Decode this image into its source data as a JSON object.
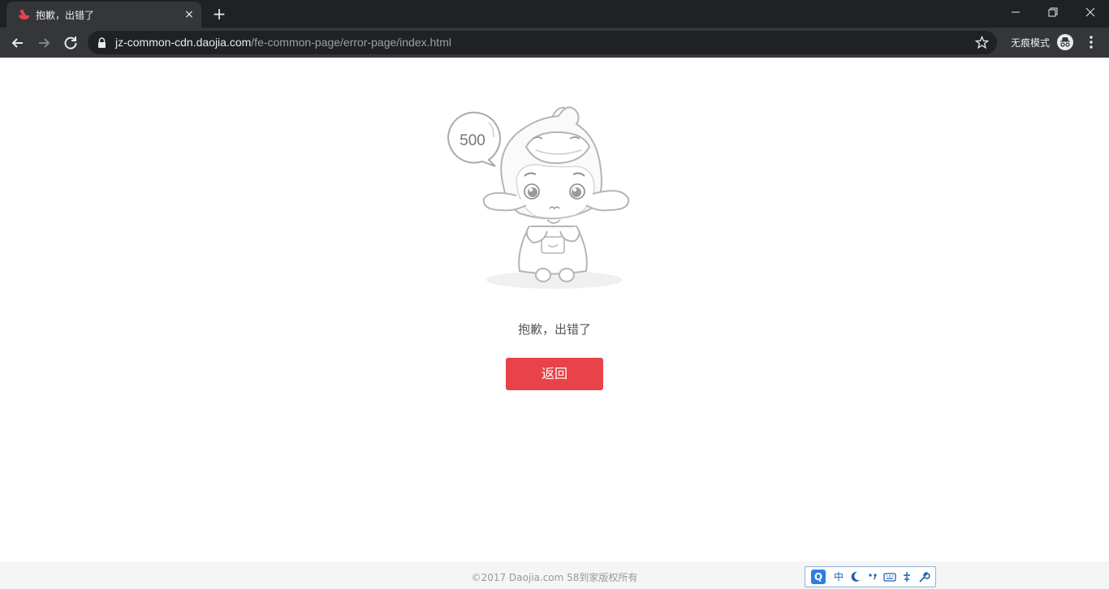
{
  "browser": {
    "tab": {
      "title": "抱歉，出错了",
      "close_label": "×"
    },
    "new_tab_label": "+",
    "url": {
      "host": "jz-common-cdn.daojia.com",
      "path": "/fe-common-page/error-page/index.html"
    },
    "incognito_label": "无痕模式"
  },
  "page": {
    "badge_code": "500",
    "error_message": "抱歉，出错了",
    "back_button_label": "返回",
    "footer_text": "©2017 Daojia.com 58到家版权所有",
    "accent_color": "#e84349"
  },
  "ime": {
    "logo": "Q",
    "mode": "中",
    "items": [
      "moon-icon",
      "punctuation-icon",
      "keyboard-icon",
      "tools-icon",
      "wrench-icon"
    ]
  }
}
